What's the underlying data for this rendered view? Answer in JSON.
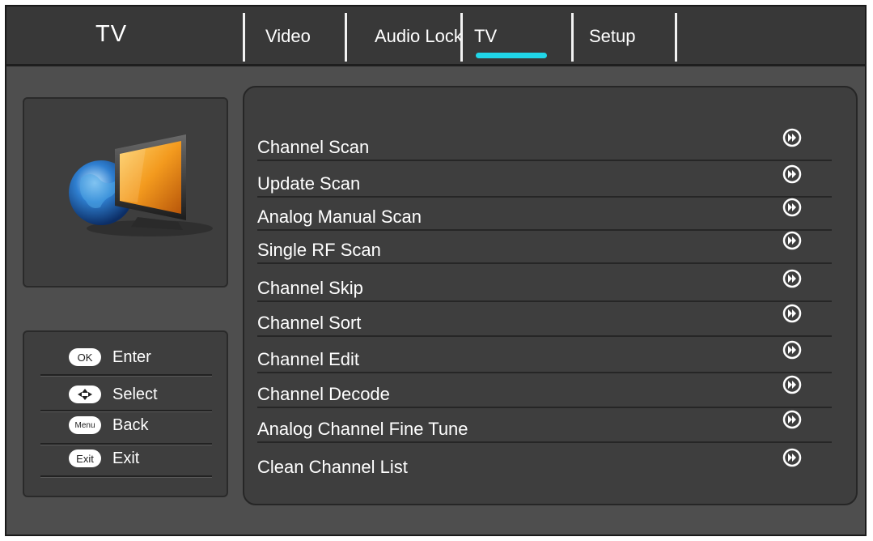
{
  "header": {
    "title": "TV",
    "tabs": [
      {
        "label": "Video"
      },
      {
        "label": "Audio Lock"
      },
      {
        "label": "TV"
      },
      {
        "label": "Setup"
      }
    ]
  },
  "help": {
    "ok": {
      "badge": "OK",
      "label": "Enter"
    },
    "select": {
      "label": "Select"
    },
    "menu": {
      "badge": "Menu",
      "label": "Back"
    },
    "exit": {
      "badge": "Exit",
      "label": "Exit"
    }
  },
  "menu": {
    "items": [
      {
        "label": "Channel Scan"
      },
      {
        "label": "Update Scan"
      },
      {
        "label": "Analog Manual Scan"
      },
      {
        "label": "Single RF Scan"
      },
      {
        "label": "Channel Skip"
      },
      {
        "label": "Channel Sort"
      },
      {
        "label": "Channel Edit"
      },
      {
        "label": "Channel Decode"
      },
      {
        "label": "Analog Channel Fine Tune"
      },
      {
        "label": "Clean Channel List"
      }
    ]
  },
  "colors": {
    "accent": "#20d6e8",
    "background": "#4e4e4e",
    "panel": "#3e3e3e"
  },
  "icons": {
    "section": "tv-globe-icon",
    "item_arrow": "forward-arrow-icon"
  }
}
